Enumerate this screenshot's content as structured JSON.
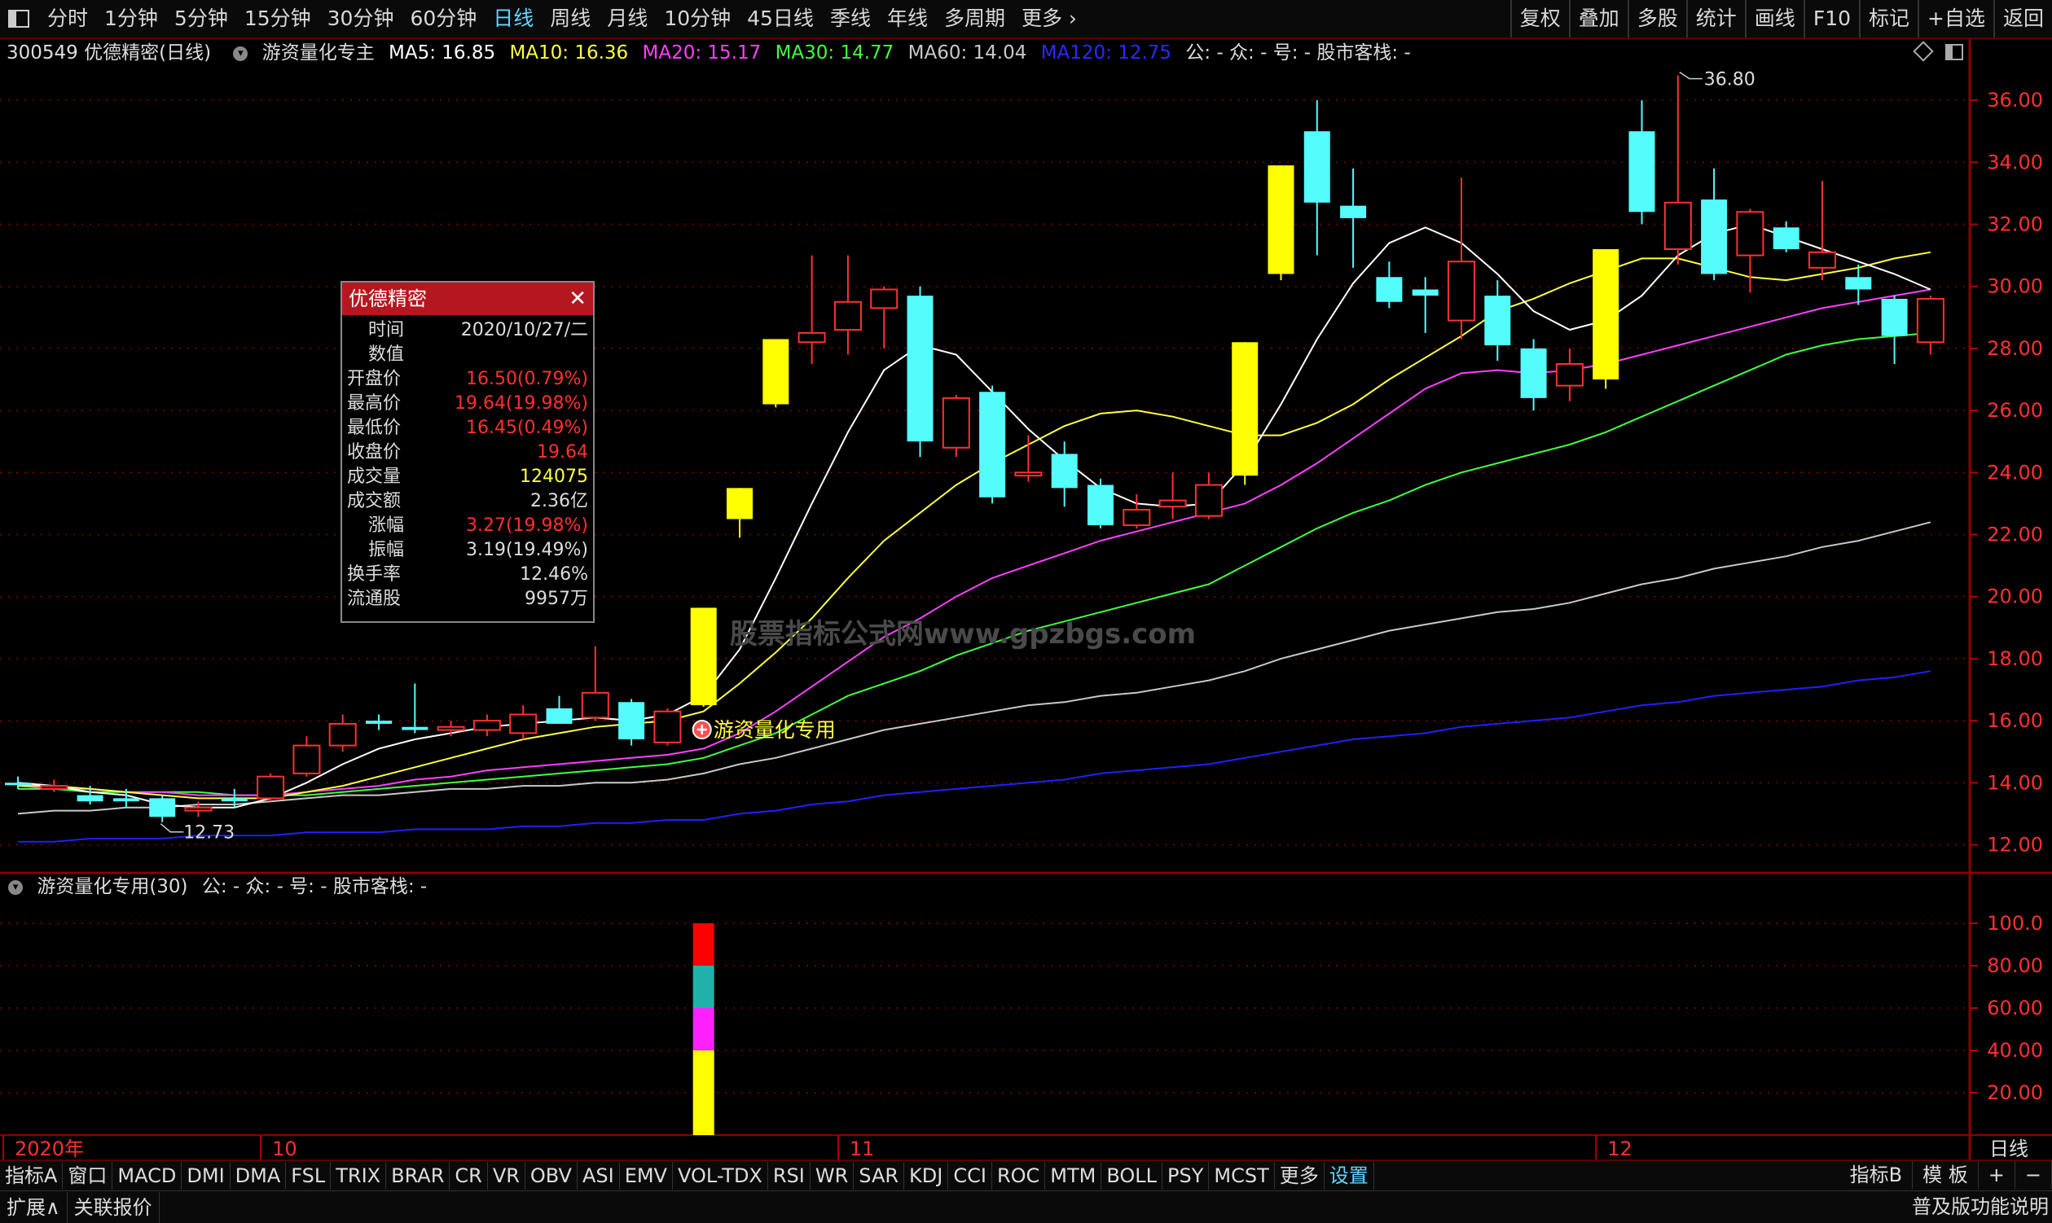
{
  "topbar": {
    "periods": [
      "分时",
      "1分钟",
      "5分钟",
      "15分钟",
      "30分钟",
      "60分钟",
      "日线",
      "周线",
      "月线",
      "10分钟",
      "45日线",
      "季线",
      "年线",
      "多周期",
      "更多"
    ],
    "active_period": "日线",
    "right_buttons": [
      "复权",
      "叠加",
      "多股",
      "统计",
      "画线",
      "F10",
      "标记",
      "+自选",
      "返回"
    ]
  },
  "info": {
    "stock": "300549 优德精密(日线)",
    "indicator": "游资量化专主",
    "ma5": "MA5: 16.85",
    "ma10": "MA10: 16.36",
    "ma20": "MA20: 15.17",
    "ma30": "MA30: 14.77",
    "ma60": "MA60: 14.04",
    "ma120": "MA120: 12.75",
    "extra": "公: -  众: -  号: -  股市客栈: -"
  },
  "colors": {
    "ma5": "#ffffff",
    "ma10": "#ffff40",
    "ma20": "#ff40ff",
    "ma30": "#40ff40",
    "ma60": "#c8c8c8",
    "ma120": "#2020ff",
    "up": "#ff3030",
    "down": "#54fcfc",
    "special": "#ffff00",
    "grid": "#8b0000"
  },
  "subinfo": {
    "title": "游资量化专用(30)",
    "extra": "公: -  众: -  号: -  股市客栈: -"
  },
  "popup": {
    "title": "优德精密",
    "rows": [
      {
        "k": "时间",
        "v": "2020/10/27/二",
        "c": "#dddddd",
        "indent": true
      },
      {
        "k": "数值",
        "v": "",
        "c": "#dddddd",
        "indent": true
      },
      {
        "k": "开盘价",
        "v": "16.50(0.79%)",
        "c": "#ff3030",
        "indent": false
      },
      {
        "k": "最高价",
        "v": "19.64(19.98%)",
        "c": "#ff3030",
        "indent": false
      },
      {
        "k": "最低价",
        "v": "16.45(0.49%)",
        "c": "#ff3030",
        "indent": false
      },
      {
        "k": "收盘价",
        "v": "19.64",
        "c": "#ff3030",
        "indent": false
      },
      {
        "k": "成交量",
        "v": "124075",
        "c": "#ffff40",
        "indent": false
      },
      {
        "k": "成交额",
        "v": "2.36亿",
        "c": "#dddddd",
        "indent": false
      },
      {
        "k": "涨幅",
        "v": "3.27(19.98%)",
        "c": "#ff3030",
        "indent": true
      },
      {
        "k": "振幅",
        "v": "3.19(19.49%)",
        "c": "#dddddd",
        "indent": true
      },
      {
        "k": "换手率",
        "v": "12.46%",
        "c": "#dddddd",
        "indent": false
      },
      {
        "k": "流通股",
        "v": "9957万",
        "c": "#dddddd",
        "indent": false
      }
    ]
  },
  "annotations": {
    "high_label": "36.80",
    "low_label": "12.73",
    "signal_label": "游资量化专用",
    "watermark": "股票指标公式网www.gpzbgs.com"
  },
  "chart_data": {
    "type": "candlestick",
    "y_ticks": [
      "36.00",
      "34.00",
      "32.00",
      "30.00",
      "28.00",
      "26.00",
      "24.00",
      "22.00",
      "20.00",
      "18.00",
      "16.00",
      "14.00",
      "12.00"
    ],
    "ylim": [
      11.2,
      37.0
    ],
    "x_labels": [
      {
        "label": "2020年",
        "index": 0
      },
      {
        "label": "10",
        "index": 7
      },
      {
        "label": "11",
        "index": 23
      },
      {
        "label": "12",
        "index": 44
      }
    ],
    "candles": [
      {
        "o": 14.0,
        "h": 14.2,
        "l": 13.8,
        "c": 14.0,
        "t": "down"
      },
      {
        "o": 13.9,
        "h": 14.1,
        "l": 13.7,
        "c": 13.8,
        "t": "up"
      },
      {
        "o": 13.6,
        "h": 13.9,
        "l": 13.3,
        "c": 13.4,
        "t": "down"
      },
      {
        "o": 13.5,
        "h": 13.8,
        "l": 13.2,
        "c": 13.4,
        "t": "down"
      },
      {
        "o": 13.5,
        "h": 13.6,
        "l": 12.73,
        "c": 12.9,
        "t": "down"
      },
      {
        "o": 13.1,
        "h": 13.4,
        "l": 12.9,
        "c": 13.2,
        "t": "up"
      },
      {
        "o": 13.5,
        "h": 13.8,
        "l": 13.2,
        "c": 13.4,
        "t": "down"
      },
      {
        "o": 13.5,
        "h": 14.3,
        "l": 13.4,
        "c": 14.2,
        "t": "up"
      },
      {
        "o": 14.3,
        "h": 15.5,
        "l": 14.2,
        "c": 15.2,
        "t": "up"
      },
      {
        "o": 15.2,
        "h": 16.2,
        "l": 15.0,
        "c": 15.9,
        "t": "up"
      },
      {
        "o": 16.0,
        "h": 16.2,
        "l": 15.7,
        "c": 15.9,
        "t": "down"
      },
      {
        "o": 15.8,
        "h": 17.2,
        "l": 15.6,
        "c": 15.7,
        "t": "down"
      },
      {
        "o": 15.7,
        "h": 16.0,
        "l": 15.5,
        "c": 15.8,
        "t": "up"
      },
      {
        "o": 15.7,
        "h": 16.2,
        "l": 15.5,
        "c": 16.0,
        "t": "up"
      },
      {
        "o": 15.6,
        "h": 16.5,
        "l": 15.4,
        "c": 16.2,
        "t": "up"
      },
      {
        "o": 16.4,
        "h": 16.8,
        "l": 15.9,
        "c": 15.9,
        "t": "down"
      },
      {
        "o": 16.1,
        "h": 18.4,
        "l": 16.0,
        "c": 16.9,
        "t": "up"
      },
      {
        "o": 16.6,
        "h": 16.7,
        "l": 15.2,
        "c": 15.4,
        "t": "down"
      },
      {
        "o": 15.3,
        "h": 16.4,
        "l": 15.2,
        "c": 16.3,
        "t": "up"
      },
      {
        "o": 16.5,
        "h": 19.64,
        "l": 16.45,
        "c": 19.64,
        "t": "special"
      },
      {
        "o": 22.5,
        "h": 23.5,
        "l": 21.9,
        "c": 23.5,
        "t": "special"
      },
      {
        "o": 26.2,
        "h": 28.3,
        "l": 26.1,
        "c": 28.3,
        "t": "special"
      },
      {
        "o": 28.2,
        "h": 31.0,
        "l": 27.5,
        "c": 28.5,
        "t": "up"
      },
      {
        "o": 28.6,
        "h": 31.0,
        "l": 27.8,
        "c": 29.5,
        "t": "up"
      },
      {
        "o": 29.3,
        "h": 30.0,
        "l": 28.0,
        "c": 29.9,
        "t": "up"
      },
      {
        "o": 29.7,
        "h": 30.0,
        "l": 24.5,
        "c": 25.0,
        "t": "down"
      },
      {
        "o": 24.8,
        "h": 26.5,
        "l": 24.5,
        "c": 26.4,
        "t": "up"
      },
      {
        "o": 26.6,
        "h": 26.8,
        "l": 23.0,
        "c": 23.2,
        "t": "down"
      },
      {
        "o": 23.9,
        "h": 25.2,
        "l": 23.7,
        "c": 24.0,
        "t": "up"
      },
      {
        "o": 24.6,
        "h": 25.0,
        "l": 22.9,
        "c": 23.5,
        "t": "down"
      },
      {
        "o": 23.6,
        "h": 23.8,
        "l": 22.2,
        "c": 22.3,
        "t": "down"
      },
      {
        "o": 22.3,
        "h": 23.3,
        "l": 22.2,
        "c": 22.8,
        "t": "up"
      },
      {
        "o": 22.9,
        "h": 24.0,
        "l": 22.5,
        "c": 23.1,
        "t": "up"
      },
      {
        "o": 22.6,
        "h": 24.0,
        "l": 22.5,
        "c": 23.6,
        "t": "up"
      },
      {
        "o": 23.9,
        "h": 28.2,
        "l": 23.6,
        "c": 28.2,
        "t": "special"
      },
      {
        "o": 30.4,
        "h": 33.9,
        "l": 30.2,
        "c": 33.9,
        "t": "special"
      },
      {
        "o": 35.0,
        "h": 36.0,
        "l": 31.0,
        "c": 32.7,
        "t": "down"
      },
      {
        "o": 32.6,
        "h": 33.8,
        "l": 30.6,
        "c": 32.2,
        "t": "down"
      },
      {
        "o": 30.3,
        "h": 30.8,
        "l": 29.3,
        "c": 29.5,
        "t": "down"
      },
      {
        "o": 29.9,
        "h": 30.3,
        "l": 28.5,
        "c": 29.7,
        "t": "down"
      },
      {
        "o": 28.9,
        "h": 33.5,
        "l": 28.3,
        "c": 30.8,
        "t": "up"
      },
      {
        "o": 29.7,
        "h": 30.2,
        "l": 27.6,
        "c": 28.1,
        "t": "down"
      },
      {
        "o": 28.0,
        "h": 28.3,
        "l": 26.0,
        "c": 26.4,
        "t": "down"
      },
      {
        "o": 26.8,
        "h": 28.0,
        "l": 26.3,
        "c": 27.5,
        "t": "up"
      },
      {
        "o": 27.0,
        "h": 31.2,
        "l": 26.7,
        "c": 31.2,
        "t": "special"
      },
      {
        "o": 35.0,
        "h": 36.0,
        "l": 32.0,
        "c": 32.4,
        "t": "down"
      },
      {
        "o": 31.2,
        "h": 36.8,
        "l": 30.7,
        "c": 32.7,
        "t": "up"
      },
      {
        "o": 32.8,
        "h": 33.8,
        "l": 30.2,
        "c": 30.4,
        "t": "down"
      },
      {
        "o": 31.0,
        "h": 32.5,
        "l": 29.8,
        "c": 32.4,
        "t": "up"
      },
      {
        "o": 31.9,
        "h": 32.1,
        "l": 31.1,
        "c": 31.2,
        "t": "down"
      },
      {
        "o": 30.6,
        "h": 33.4,
        "l": 30.2,
        "c": 31.1,
        "t": "up"
      },
      {
        "o": 29.9,
        "h": 30.7,
        "l": 29.4,
        "c": 30.3,
        "t": "down"
      },
      {
        "o": 29.6,
        "h": 29.7,
        "l": 27.5,
        "c": 28.4,
        "t": "down"
      },
      {
        "o": 28.2,
        "h": 29.7,
        "l": 27.8,
        "c": 29.6,
        "t": "up"
      }
    ],
    "ma_lines": {
      "ma5": [
        14.0,
        13.9,
        13.7,
        13.6,
        13.3,
        13.2,
        13.2,
        13.5,
        14.0,
        14.6,
        15.1,
        15.4,
        15.6,
        15.8,
        15.9,
        16.0,
        16.1,
        16.0,
        16.2,
        16.8,
        18.3,
        20.6,
        23.0,
        25.3,
        27.3,
        28.1,
        27.8,
        26.6,
        25.4,
        24.4,
        23.5,
        23.0,
        22.9,
        23.0,
        24.3,
        26.2,
        28.3,
        30.1,
        31.4,
        31.9,
        31.4,
        30.4,
        29.2,
        28.6,
        28.9,
        29.7,
        31.0,
        31.7,
        32.0,
        31.6,
        31.2,
        30.8,
        30.4,
        29.9
      ],
      "ma10": [
        13.9,
        13.9,
        13.8,
        13.7,
        13.6,
        13.5,
        13.5,
        13.5,
        13.7,
        13.9,
        14.2,
        14.5,
        14.8,
        15.1,
        15.4,
        15.6,
        15.8,
        15.9,
        16.0,
        16.3,
        17.2,
        18.2,
        19.3,
        20.6,
        21.8,
        22.7,
        23.6,
        24.3,
        24.9,
        25.5,
        25.9,
        26.0,
        25.8,
        25.5,
        25.2,
        25.2,
        25.6,
        26.2,
        27.0,
        27.7,
        28.4,
        29.2,
        29.6,
        30.1,
        30.5,
        30.9,
        30.9,
        30.6,
        30.3,
        30.2,
        30.4,
        30.6,
        30.9,
        31.1
      ],
      "ma20": [
        13.9,
        13.8,
        13.8,
        13.7,
        13.7,
        13.6,
        13.6,
        13.6,
        13.7,
        13.8,
        13.9,
        14.1,
        14.2,
        14.4,
        14.5,
        14.6,
        14.7,
        14.8,
        14.9,
        15.1,
        15.6,
        16.3,
        17.1,
        17.9,
        18.7,
        19.3,
        20.0,
        20.6,
        21.0,
        21.4,
        21.8,
        22.1,
        22.4,
        22.7,
        23.0,
        23.6,
        24.3,
        25.1,
        25.9,
        26.7,
        27.2,
        27.3,
        27.2,
        27.3,
        27.5,
        27.8,
        28.1,
        28.4,
        28.7,
        29.0,
        29.3,
        29.5,
        29.7,
        29.9
      ],
      "ma30": [
        13.8,
        13.8,
        13.7,
        13.7,
        13.7,
        13.7,
        13.6,
        13.6,
        13.6,
        13.7,
        13.8,
        13.9,
        14.0,
        14.1,
        14.2,
        14.3,
        14.4,
        14.5,
        14.6,
        14.8,
        15.2,
        15.6,
        16.2,
        16.8,
        17.2,
        17.6,
        18.1,
        18.5,
        18.9,
        19.2,
        19.5,
        19.8,
        20.1,
        20.4,
        21.0,
        21.6,
        22.2,
        22.7,
        23.1,
        23.6,
        24.0,
        24.3,
        24.6,
        24.9,
        25.3,
        25.8,
        26.3,
        26.8,
        27.3,
        27.8,
        28.1,
        28.3,
        28.4,
        28.5
      ],
      "ma60": [
        13.0,
        13.1,
        13.1,
        13.2,
        13.2,
        13.3,
        13.3,
        13.4,
        13.5,
        13.6,
        13.6,
        13.7,
        13.8,
        13.8,
        13.9,
        13.9,
        14.0,
        14.0,
        14.1,
        14.3,
        14.6,
        14.8,
        15.1,
        15.4,
        15.7,
        15.9,
        16.1,
        16.3,
        16.5,
        16.6,
        16.8,
        16.9,
        17.1,
        17.3,
        17.6,
        18.0,
        18.3,
        18.6,
        18.9,
        19.1,
        19.3,
        19.5,
        19.6,
        19.8,
        20.1,
        20.4,
        20.6,
        20.9,
        21.1,
        21.3,
        21.6,
        21.8,
        22.1,
        22.4
      ],
      "ma120": [
        12.1,
        12.1,
        12.2,
        12.2,
        12.2,
        12.3,
        12.3,
        12.3,
        12.4,
        12.4,
        12.4,
        12.5,
        12.5,
        12.5,
        12.6,
        12.6,
        12.7,
        12.7,
        12.8,
        12.8,
        13.0,
        13.1,
        13.3,
        13.4,
        13.6,
        13.7,
        13.8,
        13.9,
        14.0,
        14.1,
        14.3,
        14.4,
        14.5,
        14.6,
        14.8,
        15.0,
        15.2,
        15.4,
        15.5,
        15.6,
        15.8,
        15.9,
        16.0,
        16.1,
        16.3,
        16.5,
        16.6,
        16.8,
        16.9,
        17.0,
        17.1,
        17.3,
        17.4,
        17.6
      ]
    },
    "sub": {
      "y_ticks": [
        "100.0",
        "80.00",
        "60.00",
        "40.00",
        "20.00"
      ],
      "ylim": [
        0,
        110
      ],
      "bar_index": 19,
      "segments": [
        {
          "from": 0,
          "to": 40,
          "color": "#ffff00"
        },
        {
          "from": 40,
          "to": 60,
          "color": "#ff20ff"
        },
        {
          "from": 60,
          "to": 80,
          "color": "#20b2aa"
        },
        {
          "from": 80,
          "to": 100,
          "color": "#ff0000"
        }
      ]
    }
  },
  "tabs": {
    "items": [
      "指标A",
      "窗口",
      "MACD",
      "DMI",
      "DMA",
      "FSL",
      "TRIX",
      "BRAR",
      "CR",
      "VR",
      "OBV",
      "ASI",
      "EMV",
      "VOL-TDX",
      "RSI",
      "WR",
      "SAR",
      "KDJ",
      "CCI",
      "ROC",
      "MTM",
      "BOLL",
      "PSY",
      "MCST",
      "更多",
      "设置"
    ],
    "active": "设置",
    "right": [
      "指标B",
      "模 板",
      "+",
      "−"
    ],
    "period_label": "日线"
  },
  "status": {
    "items": [
      "扩展∧",
      "关联报价"
    ],
    "right": "普及版功能说明"
  }
}
